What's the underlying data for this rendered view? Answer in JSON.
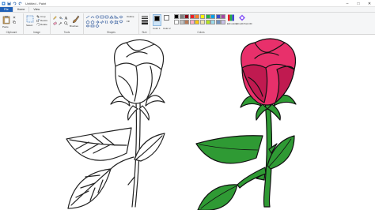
{
  "window": {
    "title": "Untitled - Paint"
  },
  "tabs": [
    {
      "label": "File"
    },
    {
      "label": "Home"
    },
    {
      "label": "View"
    }
  ],
  "ribbon": {
    "clipboard": {
      "label": "Clipboard",
      "paste_label": "Paste"
    },
    "image": {
      "label": "Image",
      "select_label": "Select",
      "crop_label": "Crop",
      "resize_label": "Resize",
      "rotate_label": "Rotate"
    },
    "tools": {
      "label": "Tools",
      "brushes_label": "Brushes"
    },
    "shapes": {
      "label": "Shapes",
      "outline_label": "Outline",
      "fill_label": "Fill"
    },
    "size": {
      "label": "Size"
    },
    "colors": {
      "label": "Colors",
      "color1_label": "Color 1",
      "color2_label": "Color 2",
      "edit_colors_label": "Edit colors",
      "edit_paint3d_label": "Edit with Paint 3D",
      "row1": [
        "#000000",
        "#7f7f7f",
        "#880015",
        "#ed1c24",
        "#ff7f27",
        "#fff200",
        "#22b14c",
        "#00a2e8",
        "#3f48cc",
        "#a349a4"
      ],
      "row2": [
        "#ffffff",
        "#c3c3c3",
        "#b97a57",
        "#ffaec9",
        "#ffc90e",
        "#efe4b0",
        "#b5e61d",
        "#99d9ea",
        "#7092be",
        "#c8bfe7"
      ],
      "color1": "#000000",
      "color2": "#ffffff"
    }
  },
  "drawing": {
    "rose_colors": {
      "petal": "#e8306b",
      "petal_shade": "#c01a50",
      "leaf": "#2f9a34",
      "leaf_dark": "#1e6e22",
      "stem": "#2f9a34"
    }
  }
}
